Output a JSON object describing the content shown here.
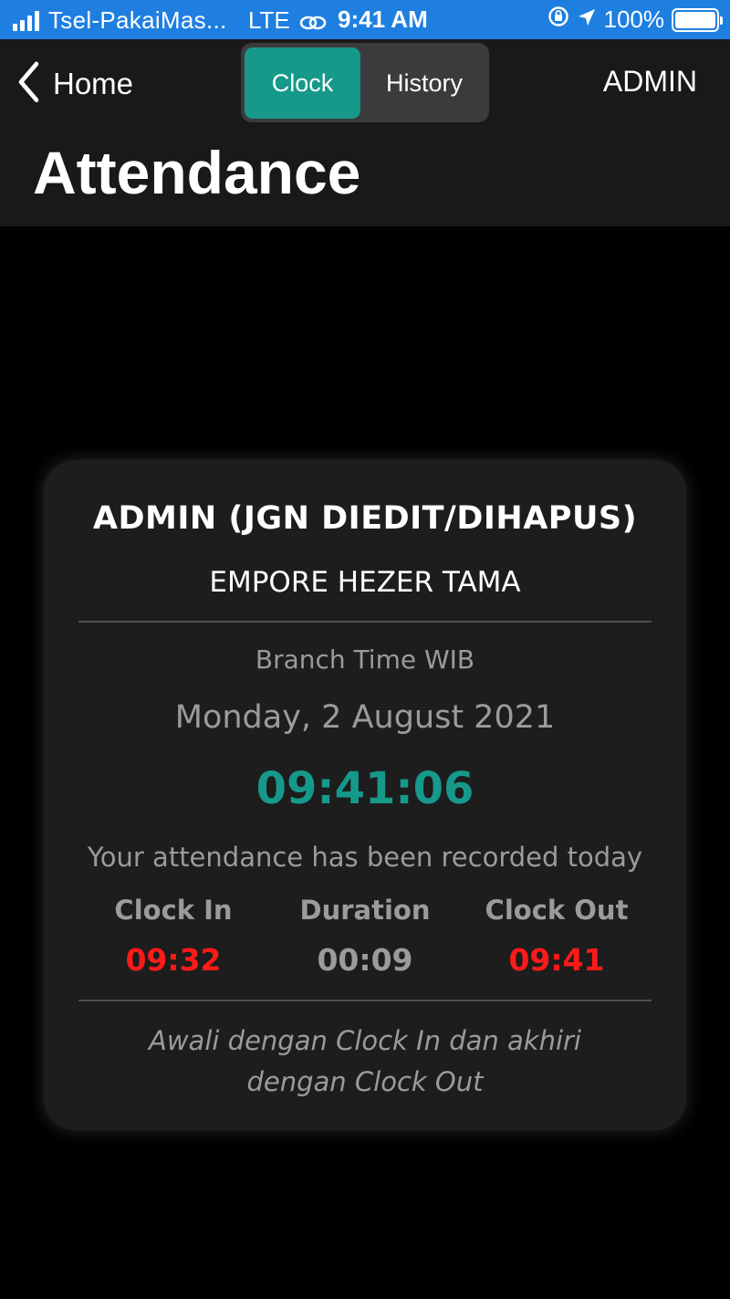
{
  "status_bar": {
    "carrier": "Tsel-PakaiMas...",
    "network": "LTE",
    "time": "9:41 AM",
    "battery_percent": "100%",
    "signal_bars": 4
  },
  "header": {
    "back_label": "Home",
    "tabs": [
      {
        "label": "Clock",
        "active": true
      },
      {
        "label": "History",
        "active": false
      }
    ],
    "user": "ADMIN",
    "title": "Attendance"
  },
  "card": {
    "employee_name": "ADMIN (JGN DIEDIT/DIHAPUS)",
    "company": "EMPORE HEZER TAMA",
    "branch_time_label": "Branch Time WIB",
    "date": "Monday, 2 August 2021",
    "current_time": "09:41:06",
    "status_message": "Your attendance has been recorded today",
    "stats": {
      "clock_in_label": "Clock In",
      "clock_in_value": "09:32",
      "duration_label": "Duration",
      "duration_value": "00:09",
      "clock_out_label": "Clock Out",
      "clock_out_value": "09:41"
    },
    "footer_note": "Awali dengan Clock In dan akhiri dengan Clock Out"
  },
  "colors": {
    "status_bar": "#1f7fe0",
    "accent": "#16998a",
    "highlight_red": "#ff1a1a",
    "header_bg": "#191919",
    "card_bg": "#1d1d1d"
  }
}
